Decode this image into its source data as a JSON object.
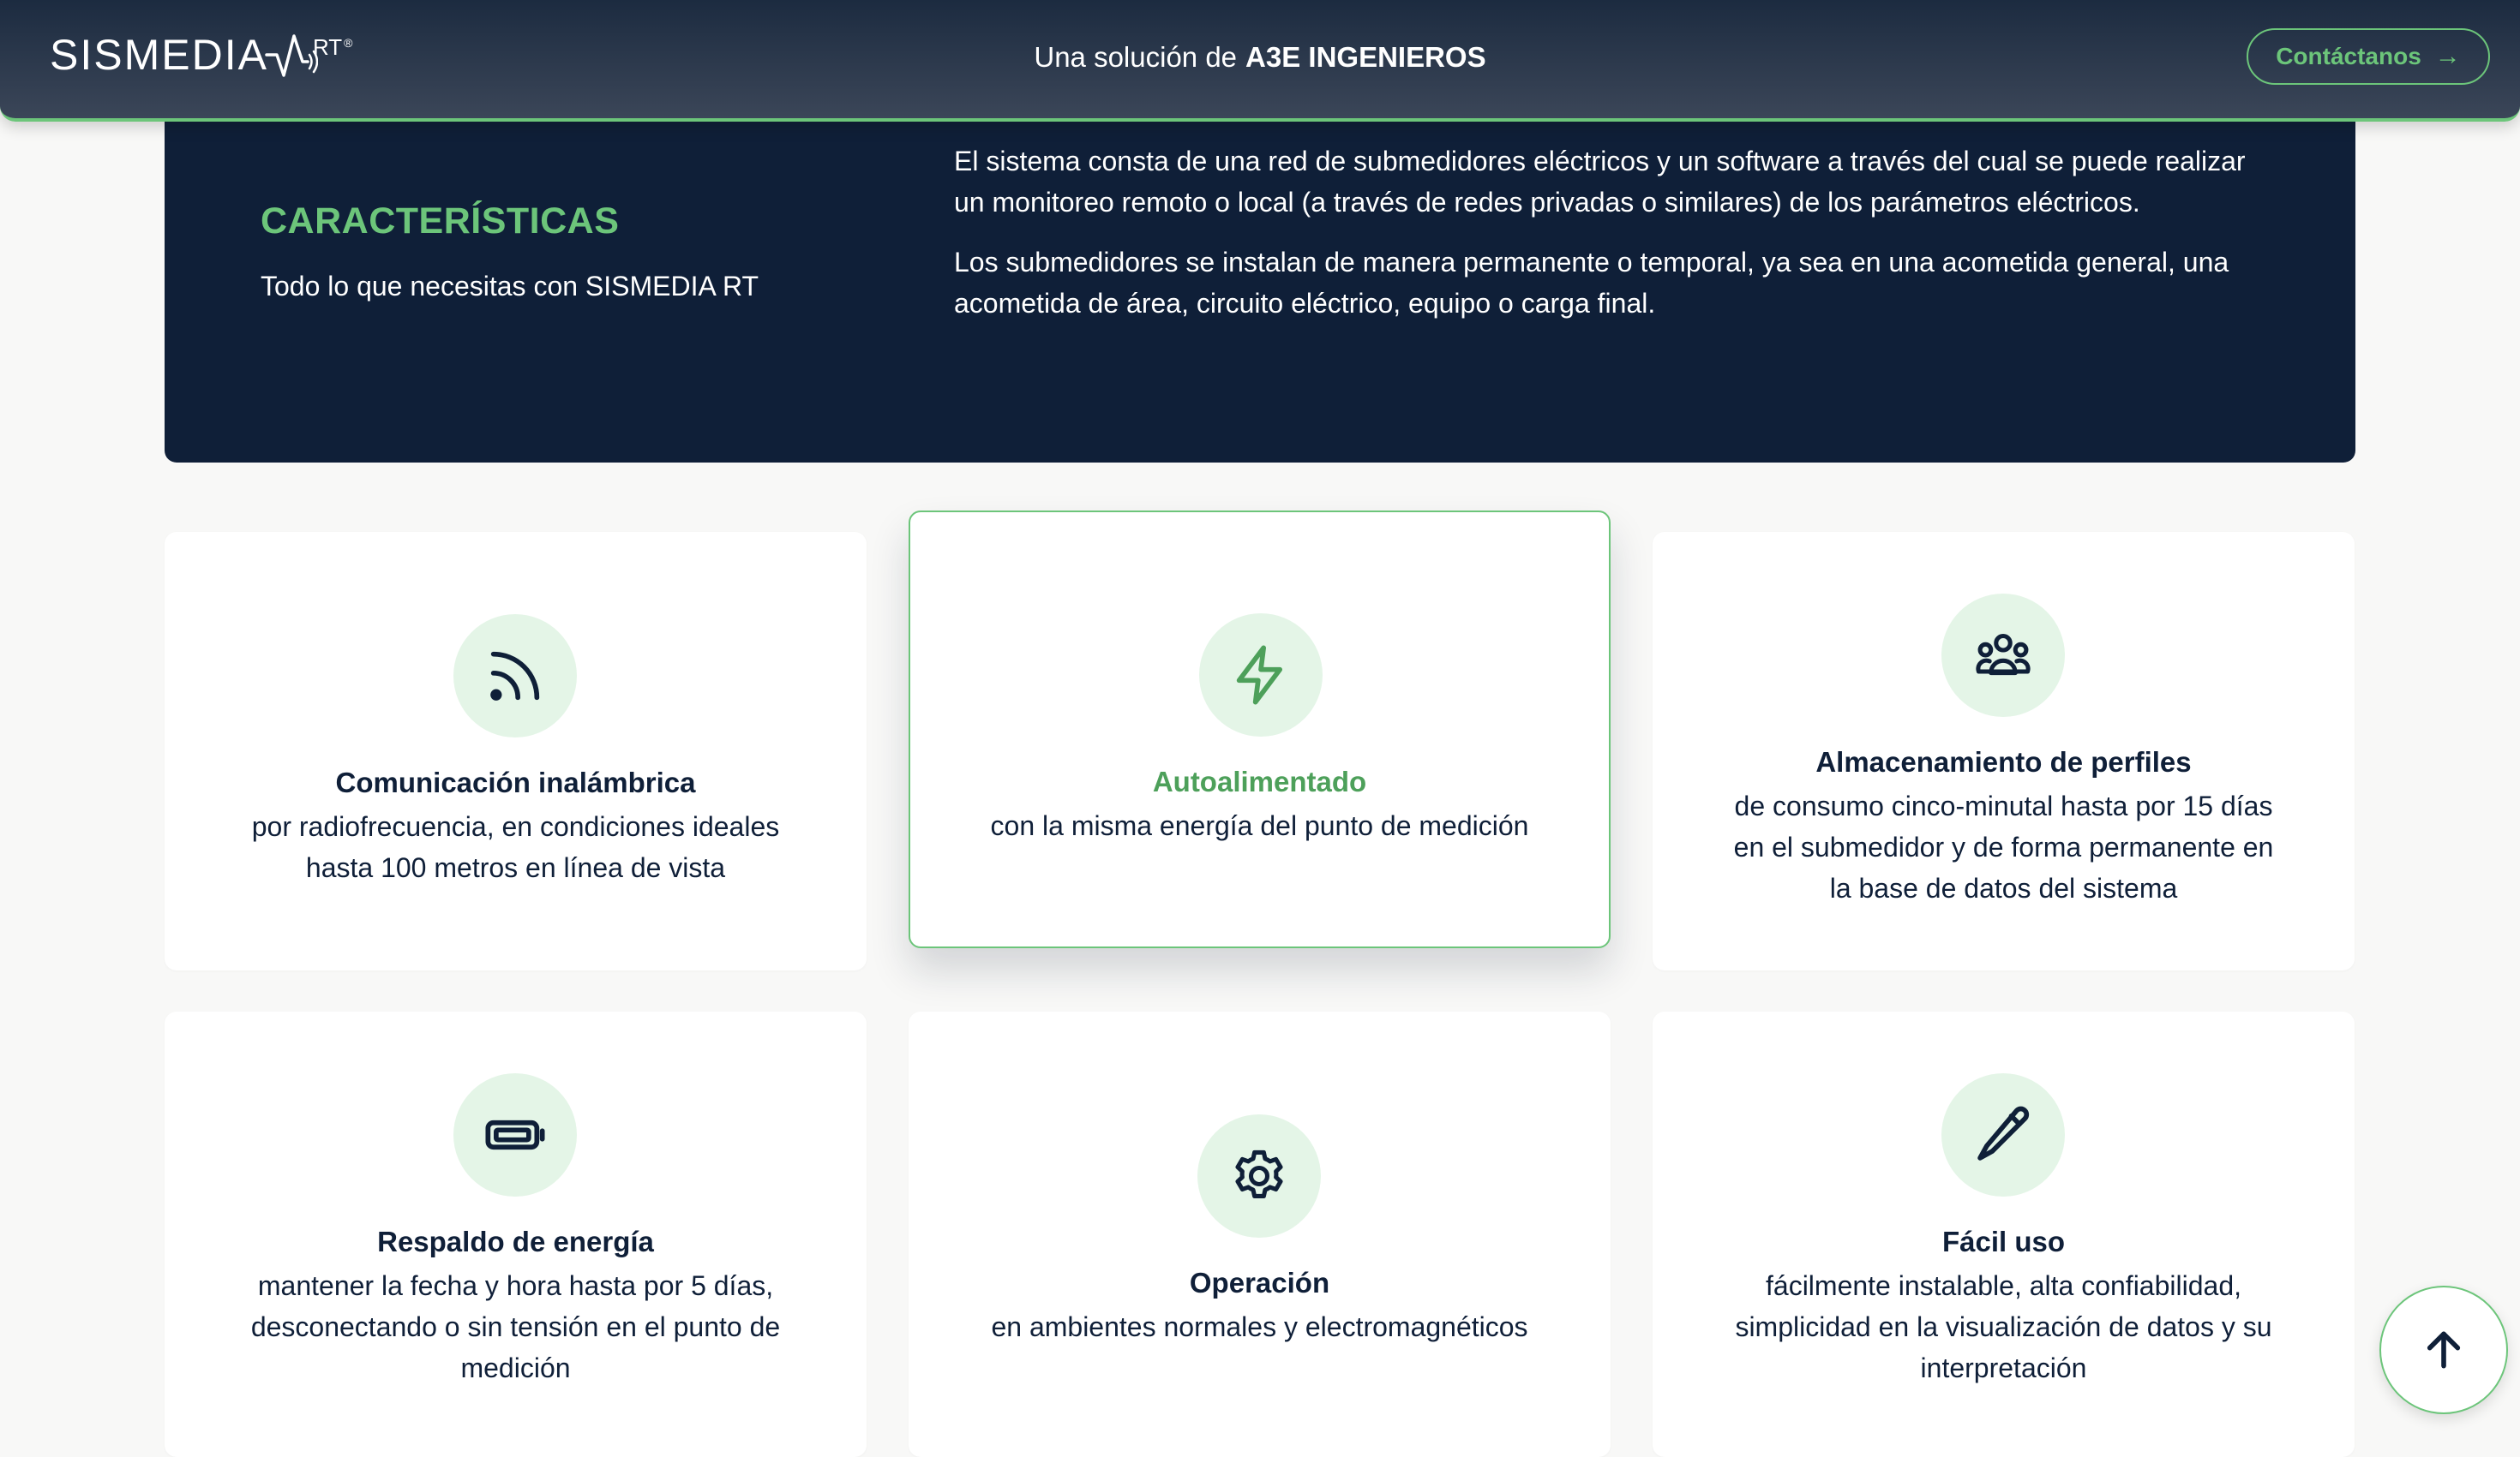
{
  "header": {
    "logo_text": "SISMEDIA",
    "logo_suffix": "RT",
    "logo_reg": "®",
    "tagline_prefix": "Una solución de",
    "tagline_brand": "A3E INGENIEROS",
    "contact_label": "Contáctanos",
    "contact_arrow": "→"
  },
  "intro": {
    "title": "CARACTERÍSTICAS",
    "subtitle": "Todo lo que necesitas con SISMEDIA RT",
    "paragraphs": [
      "El sistema consta de una red de submedidores eléctricos y un software a través del cual se puede realizar un monitoreo remoto o local (a través de redes privadas o similares) de los parámetros eléctricos.",
      "Los submedidores se instalan de manera permanente o temporal, ya sea en una acometida general, una acometida de área, circuito eléctrico, equipo o carga final."
    ]
  },
  "features": [
    {
      "icon": "wireless-icon",
      "title": "Comunicación inalámbrica",
      "desc": "por radiofrecuencia, en condiciones ideales hasta 100 metros en línea de vista"
    },
    {
      "icon": "lightning-icon",
      "title": "Autoalimentado",
      "desc": "con la misma energía del punto de medición",
      "highlighted": true
    },
    {
      "icon": "users-group-icon",
      "title": "Almacenamiento de perfiles",
      "desc": "de consumo cinco-minutal hasta por 15 días en el submedidor y de forma permanente en la base de datos del sistema"
    },
    {
      "icon": "battery-icon",
      "title": "Respaldo de energía",
      "desc": "mantener la fecha y hora hasta por 5 días, desconectando o sin tensión en el punto de medición"
    },
    {
      "icon": "gear-icon",
      "title": "Operación",
      "desc": "en ambientes normales y electromagnéticos"
    },
    {
      "icon": "pencil-icon",
      "title": "Fácil uso",
      "desc": "fácilmente instalable, alta confiabilidad, simplicidad en la visualización de datos y su interpretación"
    }
  ],
  "colors": {
    "accent_green": "#6cc57a",
    "dark_navy": "#0f1f38",
    "icon_bg": "#e4f5e7"
  },
  "scroll_top_icon": "arrow-up-icon"
}
